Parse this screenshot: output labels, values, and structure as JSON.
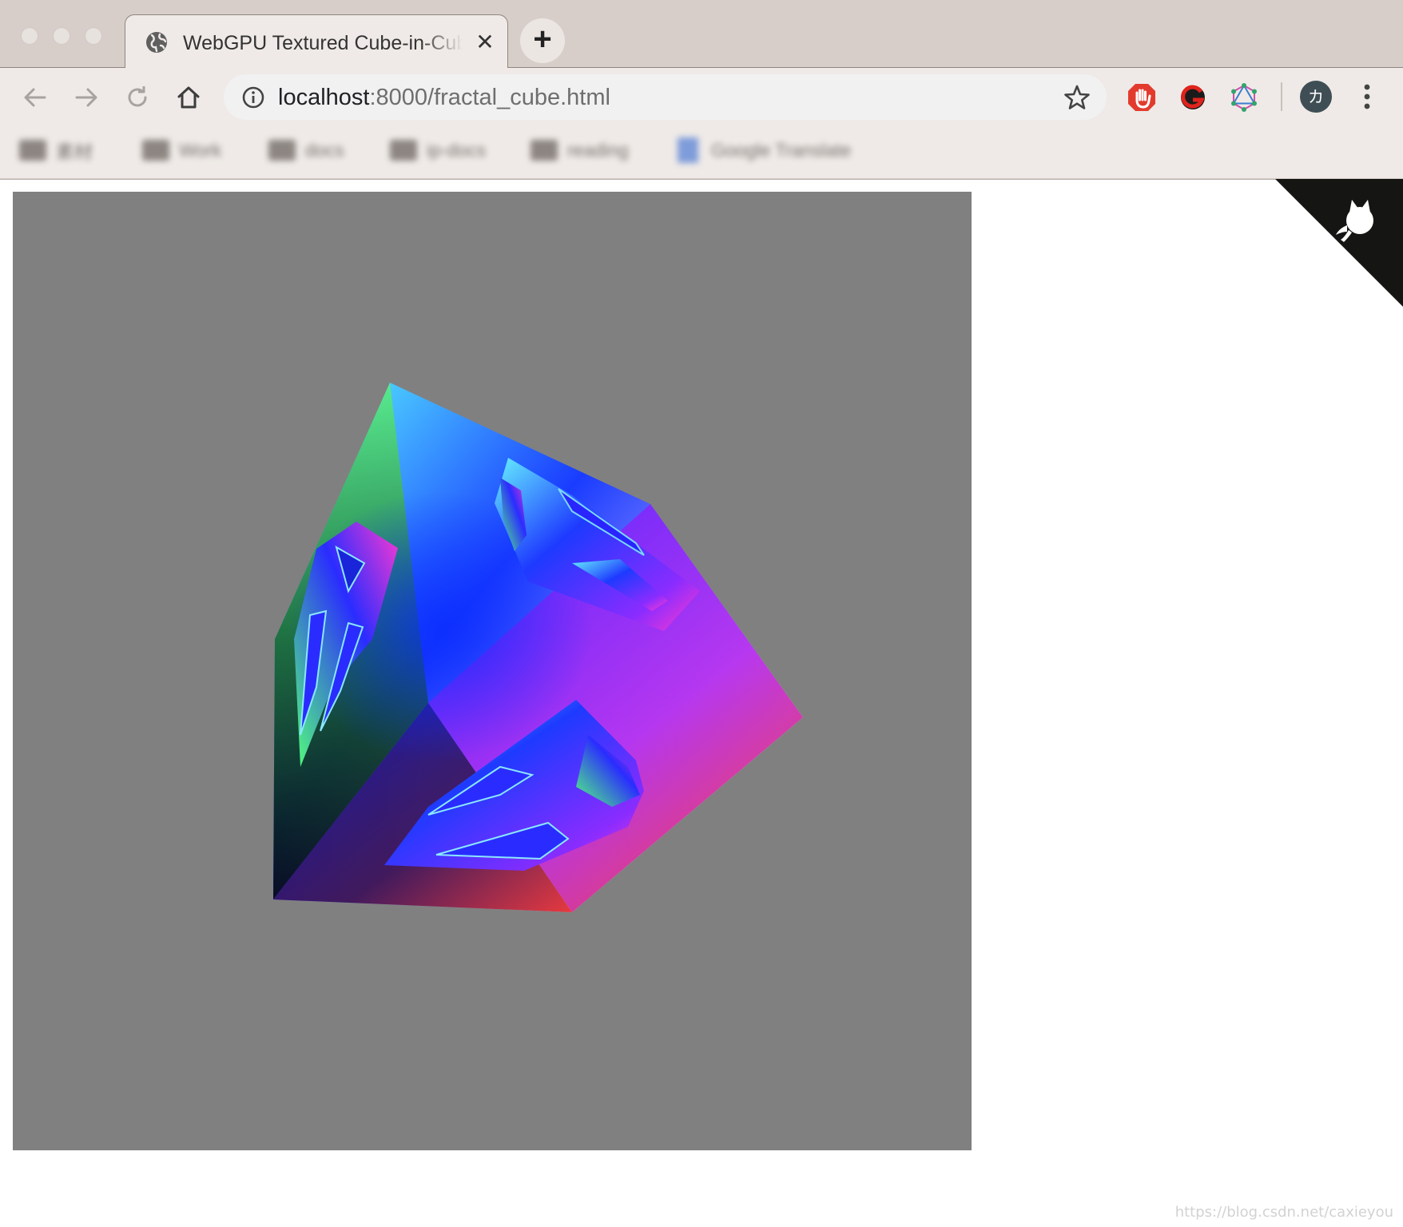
{
  "browser": {
    "tab": {
      "title": "WebGPU Textured Cube-in-Cube",
      "favicon": "globe-icon",
      "close_glyph": "✕"
    },
    "new_tab_glyph": "+",
    "address_bar": {
      "host": "localhost",
      "path": ":8000/fractal_cube.html"
    },
    "avatar_initial": "カ",
    "extensions": [
      "adblock-hand-icon",
      "red-g-extension-icon",
      "graphql-icon"
    ],
    "bookmarks": [
      {
        "label": "素材",
        "icon": "folder-icon"
      },
      {
        "label": "Work",
        "icon": "folder-icon"
      },
      {
        "label": "docs",
        "icon": "folder-icon"
      },
      {
        "label": "ip-docs",
        "icon": "folder-icon"
      },
      {
        "label": "reading",
        "icon": "folder-icon"
      },
      {
        "label": "Google Translate",
        "icon": "google-doc-icon"
      }
    ]
  },
  "page": {
    "canvas_background": "#808080",
    "github_corner_icon": "octocat-icon",
    "watermark": "https://blog.csdn.net/caxieyou"
  }
}
